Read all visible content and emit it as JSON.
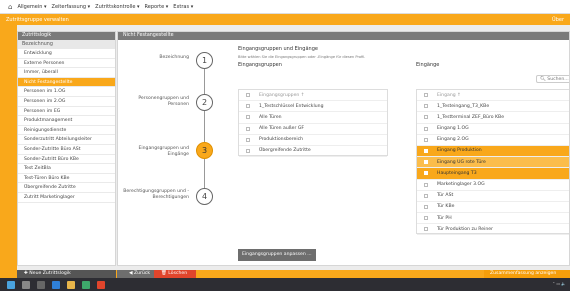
{
  "topbar": {
    "menu": [
      "Allgemein ▾",
      "Zeiterfassung ▾",
      "Zutrittskontrolle ▾",
      "Reporte ▾",
      "Extras ▾"
    ]
  },
  "subbar": {
    "left": "Zutrittsgruppe verwalten",
    "right": "Über"
  },
  "sidebar": {
    "header": "Zutrittslogik",
    "subheader": "Bezeichnung",
    "items": [
      "Entwicklung",
      "Externe Personen",
      "Immer, überall",
      "Nicht Festangestellte",
      "Personen im 1.OG",
      "Personen im 2.OG",
      "Personen im EG",
      "Produktmanagement",
      "Reinigungsdienste",
      "Sonderzutritt Abteilungsleiter",
      "Sonder-Zutritte Büro ASt",
      "Sonder-Zutritt Büro KBe",
      "Test ZeitBla",
      "Test-Türen Büro KBe",
      "Übergreifende Zutritte",
      "Zutritt Marketinglager"
    ],
    "active_index": 3
  },
  "main": {
    "header": "Nicht Festangestellte",
    "section_title": "Eingangsgruppen und Eingänge",
    "section_desc": "Bitte wählen Sie die Eingangsgruppen oder -Eingänge für diesen Profil.",
    "steps": [
      {
        "num": "1",
        "label": "Bezeichnung"
      },
      {
        "num": "2",
        "label": "Personengruppen und Personen"
      },
      {
        "num": "3",
        "label": "Eingangsgruppen und Eingänge"
      },
      {
        "num": "4",
        "label": "Berechtigungsgruppen und -Berechtigungen"
      }
    ],
    "active_step": 2,
    "groups": {
      "title": "Eingangsgruppen",
      "search": "Suchen...",
      "header": "Eingangsgruppen ↑",
      "items": [
        "1_Testschlüssel Entwicklung",
        "Alle Türen",
        "Alle Türen außer GF",
        "Produktionsbereich",
        "Übergreifende Zutritte"
      ]
    },
    "entries": {
      "title": "Eingänge",
      "search": "Suchen...",
      "header": "Eingang ↑",
      "items": [
        "1_Testeingang_T3_KBe",
        "1_Testterminal ZEF_Büro KBe",
        "Eingang 1.OG",
        "Eingang 2.OG",
        "Eingang Produktion",
        "Eingang UG rote Türe",
        "Haupteingang T3",
        "Marketinglager 3.OG",
        "Tür ASt",
        "Tür KBe",
        "Tür PH",
        "Tür Produktion zu Reiner"
      ],
      "selected": [
        4,
        5,
        6
      ]
    },
    "adjust_button": "Eingangsgruppen anpassen ..."
  },
  "bottom": {
    "new": "✚ Neue Zutrittslogik",
    "back": "◀ Zurück",
    "delete": "🗑 Löschen",
    "save": "Zusammenfassung anzeigen"
  }
}
